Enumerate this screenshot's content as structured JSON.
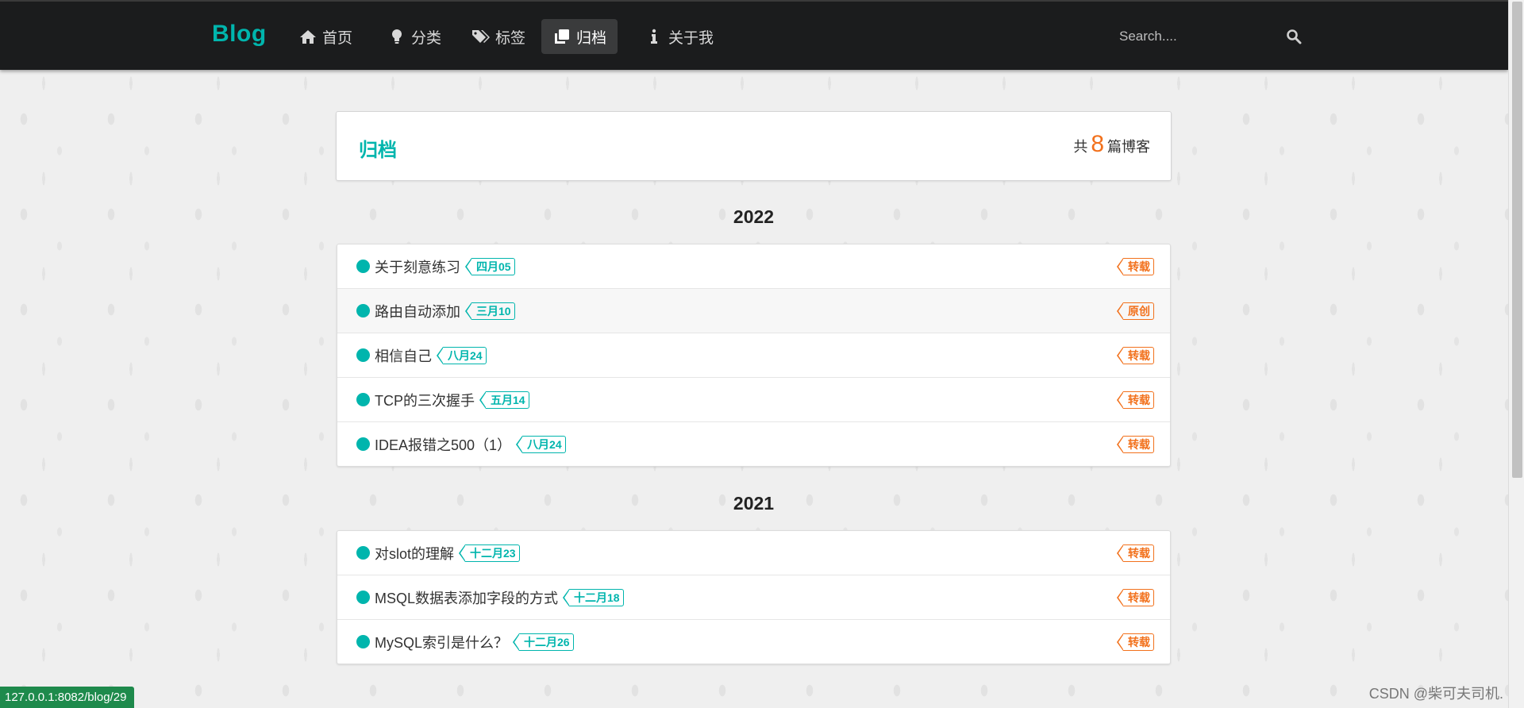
{
  "nav": {
    "brand": "Blog",
    "items": [
      {
        "label": "首页",
        "icon": "home-icon"
      },
      {
        "label": "分类",
        "icon": "lightbulb-icon"
      },
      {
        "label": "标签",
        "icon": "tags-icon"
      },
      {
        "label": "归档",
        "icon": "clone-icon",
        "active": true
      },
      {
        "label": "关于我",
        "icon": "info-icon"
      }
    ],
    "search_placeholder": "Search....",
    "search_icon": "search-icon"
  },
  "archive": {
    "title": "归档",
    "count_prefix": "共",
    "count": "8",
    "count_suffix": "篇博客"
  },
  "years": [
    {
      "year": "2022",
      "posts": [
        {
          "title": "关于刻意练习",
          "date": "四月05",
          "type": "转载"
        },
        {
          "title": "路由自动添加",
          "date": "三月10",
          "type": "原创"
        },
        {
          "title": "相信自己",
          "date": "八月24",
          "type": "转载"
        },
        {
          "title": "TCP的三次握手",
          "date": "五月14",
          "type": "转载"
        },
        {
          "title": "IDEA报错之500（1）",
          "date": "八月24",
          "type": "转载"
        }
      ]
    },
    {
      "year": "2021",
      "posts": [
        {
          "title": "对slot的理解",
          "date": "十二月23",
          "type": "转载"
        },
        {
          "title": "MSQL数据表添加字段的方式",
          "date": "十二月18",
          "type": "转载"
        },
        {
          "title": "MySQL索引是什么？",
          "date": "十二月26",
          "type": "转载"
        }
      ]
    }
  ],
  "status_url": "127.0.0.1:8082/blog/29",
  "watermark": "CSDN @柴可夫司机.",
  "colors": {
    "accent": "#00b5ad",
    "orange": "#f2711c",
    "navbar": "#1b1c1d"
  }
}
